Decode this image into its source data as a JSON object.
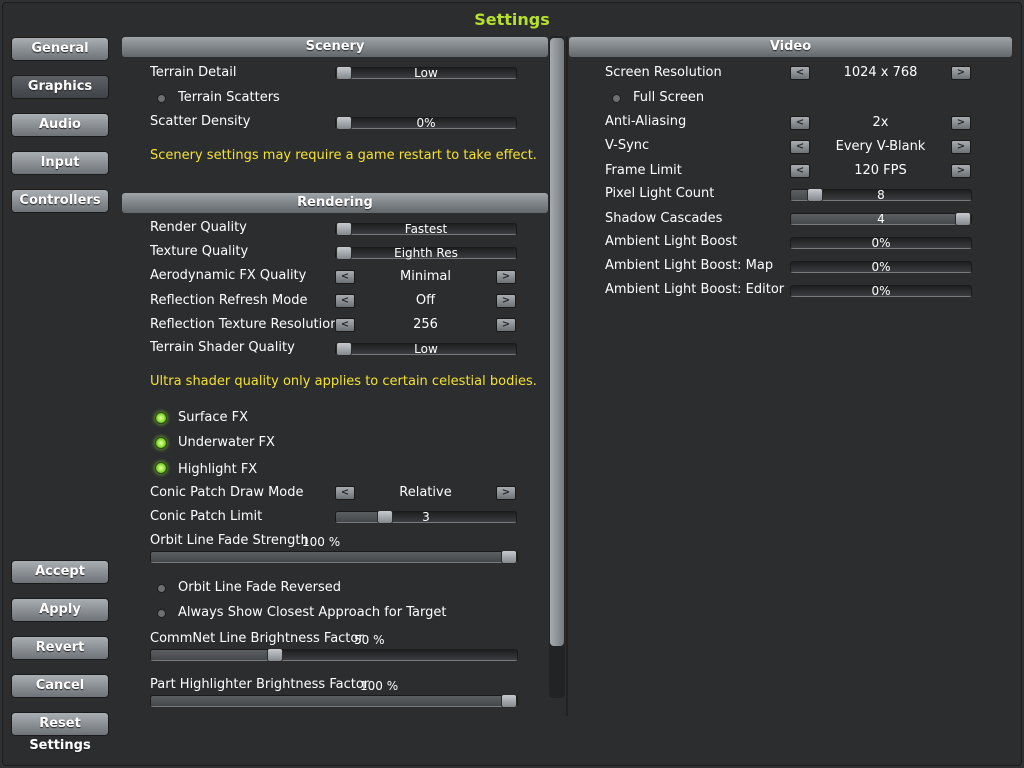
{
  "title": "Settings",
  "nav": {
    "general": "General",
    "graphics": "Graphics",
    "audio": "Audio",
    "input": "Input",
    "controllers": "Controllers"
  },
  "actions": {
    "accept": "Accept",
    "apply": "Apply",
    "revert": "Revert",
    "cancel": "Cancel",
    "reset": "Reset Settings"
  },
  "scenery": {
    "header": "Scenery",
    "terrain_detail": {
      "label": "Terrain Detail",
      "value": "Low",
      "level": 0
    },
    "terrain_scatters": {
      "label": "Terrain Scatters",
      "on": false
    },
    "scatter_density": {
      "label": "Scatter Density",
      "value": "0%",
      "level": 0
    },
    "note": "Scenery settings may require a game restart to take effect."
  },
  "rendering": {
    "header": "Rendering",
    "render_quality": {
      "label": "Render Quality",
      "value": "Fastest",
      "level": 0
    },
    "texture_quality": {
      "label": "Texture Quality",
      "value": "Eighth Res",
      "level": 0
    },
    "aero_fx": {
      "label": "Aerodynamic FX Quality",
      "value": "Minimal"
    },
    "refl_refresh": {
      "label": "Reflection Refresh Mode",
      "value": "Off"
    },
    "refl_tex_res": {
      "label": "Reflection Texture Resolution",
      "value": "256"
    },
    "terrain_shader": {
      "label": "Terrain Shader Quality",
      "value": "Low",
      "level": 0
    },
    "note": "Ultra shader quality only applies to certain celestial bodies.",
    "surface_fx": {
      "label": "Surface FX",
      "on": true
    },
    "underwater_fx": {
      "label": "Underwater FX",
      "on": true
    },
    "highlight_fx": {
      "label": "Highlight FX",
      "on": true
    },
    "conic_mode": {
      "label": "Conic Patch Draw Mode",
      "value": "Relative"
    },
    "conic_limit": {
      "label": "Conic Patch Limit",
      "value": "3",
      "level": 0.25
    },
    "orbit_fade": {
      "label": "Orbit Line Fade Strength",
      "value": "100 %",
      "level": 1.0
    },
    "orbit_reversed": {
      "label": "Orbit Line Fade Reversed",
      "on": false
    },
    "closest_approach": {
      "label": "Always Show Closest Approach for Target",
      "on": false
    },
    "commnet": {
      "label": "CommNet Line Brightness Factor",
      "value": "50 %",
      "level": 0.33
    },
    "part_highlighter": {
      "label": "Part Highlighter Brightness Factor",
      "value": "100 %",
      "level": 1.0
    }
  },
  "video": {
    "header": "Video",
    "resolution": {
      "label": "Screen Resolution",
      "value": "1024 x 768"
    },
    "fullscreen": {
      "label": "Full Screen",
      "on": false
    },
    "aa": {
      "label": "Anti-Aliasing",
      "value": "2x"
    },
    "vsync": {
      "label": "V-Sync",
      "value": "Every V-Blank"
    },
    "frame_limit": {
      "label": "Frame Limit",
      "value": "120 FPS"
    },
    "pixel_light": {
      "label": "Pixel Light Count",
      "value": "8",
      "level": 0.1
    },
    "shadow_cascades": {
      "label": "Shadow Cascades",
      "value": "4",
      "level": 1.0
    },
    "ambient": {
      "label": "Ambient Light Boost",
      "value": "0%",
      "level": 0
    },
    "ambient_map": {
      "label": "Ambient Light Boost: Map",
      "value": "0%",
      "level": 0
    },
    "ambient_editor": {
      "label": "Ambient Light Boost: Editor",
      "value": "0%",
      "level": 0
    }
  },
  "icons": {
    "left": "<",
    "right": ">"
  }
}
